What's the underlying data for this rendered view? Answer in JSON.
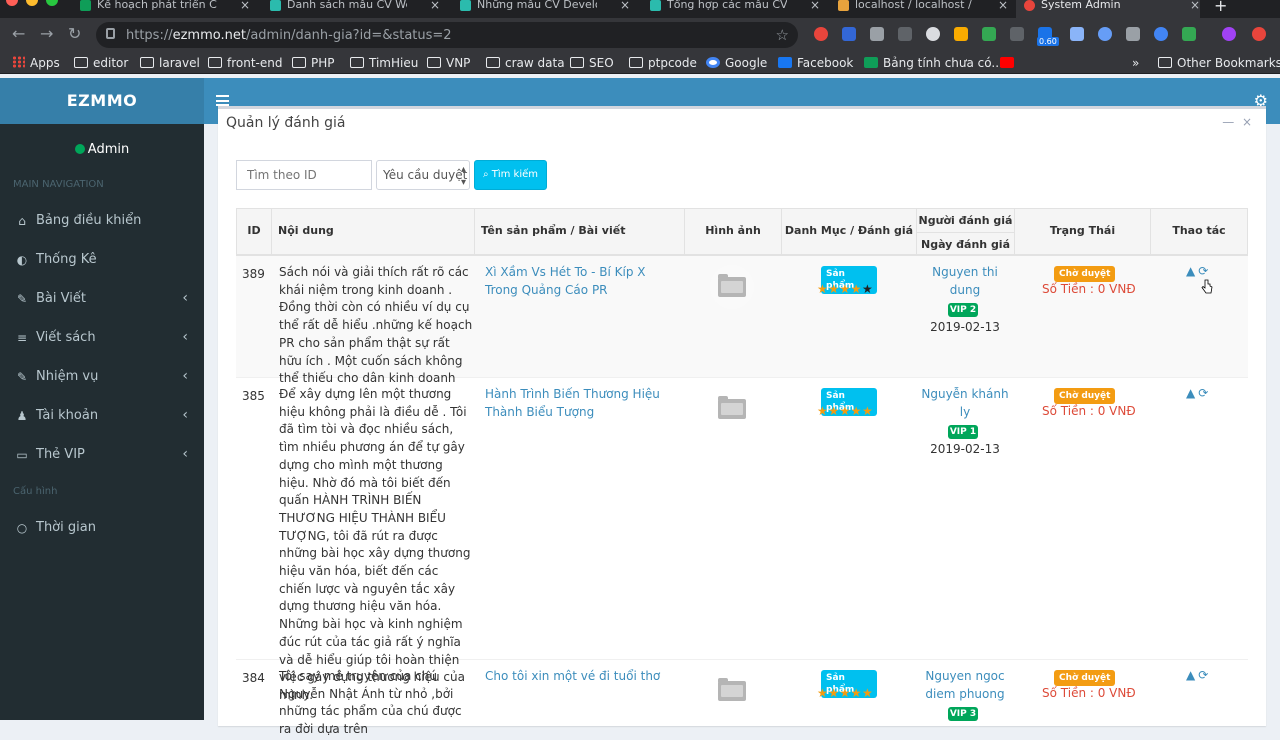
{
  "browser": {
    "tabs": [
      {
        "title": "Kế hoạch phát triển CV - C",
        "favicon_color": "#0f9d58",
        "active": false
      },
      {
        "title": "Danh sách mẫu CV Web D",
        "favicon_color": "#2bbbad",
        "active": false
      },
      {
        "title": "Những mẫu CV Developer",
        "favicon_color": "#2bbbad",
        "active": false
      },
      {
        "title": "Tổng hợp các mẫu CV Ele",
        "favicon_color": "#2bbbad",
        "active": false
      },
      {
        "title": "localhost / localhost / dua",
        "favicon_color": "#e8a33d",
        "active": false
      },
      {
        "title": "System Admin",
        "favicon_color": "#e8453c",
        "active": true
      }
    ],
    "url_prefix": "https://",
    "url_host": "ezmmo.net",
    "url_path": "/admin/danh-gia?id=&status=2",
    "bookmarks": [
      {
        "label": "Apps",
        "icon": "apps-grid-icon"
      },
      {
        "label": "editor",
        "icon": "folder-icon"
      },
      {
        "label": "laravel",
        "icon": "folder-icon"
      },
      {
        "label": "front-end",
        "icon": "folder-icon"
      },
      {
        "label": "PHP",
        "icon": "folder-icon"
      },
      {
        "label": "TimHieu",
        "icon": "folder-icon"
      },
      {
        "label": "VNP",
        "icon": "folder-icon"
      },
      {
        "label": "craw data",
        "icon": "folder-icon"
      },
      {
        "label": "SEO",
        "icon": "folder-icon"
      },
      {
        "label": "ptpcode",
        "icon": "folder-icon"
      },
      {
        "label": "Google",
        "icon": "google-icon"
      },
      {
        "label": "Facebook",
        "icon": "facebook-icon"
      },
      {
        "label": "Bảng tính chưa có...",
        "icon": "sheets-icon"
      },
      {
        "label": "",
        "icon": "youtube-icon"
      }
    ],
    "other_bookmarks": "Other Bookmarks",
    "ext_badge": "0.60"
  },
  "app": {
    "logo": "EZMMO",
    "user": "Admin",
    "main_nav_header": "MAIN NAVIGATION",
    "config_header": "Cấu hình",
    "nav": [
      {
        "label": "Bảng điều khiển",
        "icon": "dashboard-icon",
        "has_sub": false
      },
      {
        "label": "Thống Kê",
        "icon": "stats-icon",
        "has_sub": false
      },
      {
        "label": "Bài Viết",
        "icon": "edit-icon",
        "has_sub": true
      },
      {
        "label": "Viết sách",
        "icon": "database-icon",
        "has_sub": true
      },
      {
        "label": "Nhiệm vụ",
        "icon": "edit-icon",
        "has_sub": true
      },
      {
        "label": "Tài khoản",
        "icon": "user-icon",
        "has_sub": true
      },
      {
        "label": "Thẻ VIP",
        "icon": "card-icon",
        "has_sub": true
      }
    ],
    "config_nav": [
      {
        "label": "Thời gian",
        "icon": "circle-icon"
      }
    ]
  },
  "panel": {
    "title": "Quản lý đánh giá",
    "search_placeholder": "Tìm theo ID",
    "status_selected": "Yêu cầu duyệt",
    "search_button": "Tìm kiếm"
  },
  "table": {
    "headers": {
      "id": "ID",
      "content": "Nội dung",
      "product": "Tên sản phẩm / Bài viết",
      "image": "Hình ảnh",
      "category": "Danh Mục / Đánh giá",
      "reviewer": "Người đánh giá",
      "review_date": "Ngày đánh giá",
      "status": "Trạng Thái",
      "actions": "Thao tác"
    },
    "rows": [
      {
        "id": "389",
        "content": "Sách nói và giải thích rất rõ các khái niệm trong kinh doanh . Đồng thời còn có nhiều ví dụ cụ thể rất dễ hiểu .những kế hoạch PR cho sản phẩm thật sự rất hữu ích . Một cuốn sách không thể thiếu cho dân kinh doanh",
        "product": "Xì Xầm Vs Hét To - Bí Kíp X Trong Quảng Cáo PR",
        "category": "Sản phẩm",
        "rating": 4,
        "reviewer": "Nguyen thi dung",
        "vip": "VIP 2",
        "date": "2019-02-13",
        "status": "Chờ duyệt",
        "money": "Số Tiền : 0 VNĐ"
      },
      {
        "id": "385",
        "content": "Để xây dựng lên một thương hiệu không phải là điều dễ . Tôi đã tìm tòi và đọc nhiều sách, tìm nhiều phương án để tự gây dựng cho mình một thương hiệu. Nhờ đó mà tôi biết đến quấn HÀNH TRÌNH BIẾN THƯƠNG HIỆU THÀNH BIỂU TƯỢNG, tôi đã rút ra được những bài học xây dựng thương hiệu văn hóa, biết đến các chiến lược và nguyên tắc xây dựng thương hiệu văn hóa. Những bài học và kinh nghiệm đúc rút của tác giả rất ý nghĩa và dễ hiểu giúp tôi hoàn thiện việc gây dựng thương hiệu của mình.",
        "product": "Hành Trình Biến Thương Hiệu Thành Biểu Tượng",
        "category": "Sản phẩm",
        "rating": 5,
        "reviewer": "Nguyễn khánh ly",
        "vip": "VIP 1",
        "date": "2019-02-13",
        "status": "Chờ duyệt",
        "money": "Số Tiền : 0 VNĐ"
      },
      {
        "id": "384",
        "content": "Tôi say mê truyện của chú Nguyễn Nhật Ánh từ nhỏ ,bởi những tác phẩm của chú được ra đời dựa trên",
        "product": "Cho tôi xin một vé đi tuổi thơ",
        "category": "Sản phẩm",
        "rating": 5,
        "reviewer": "Nguyen ngoc diem phuong",
        "vip": "VIP 3",
        "date": "",
        "status": "Chờ duyệt",
        "money": "Số Tiền : 0 VNĐ"
      }
    ]
  }
}
